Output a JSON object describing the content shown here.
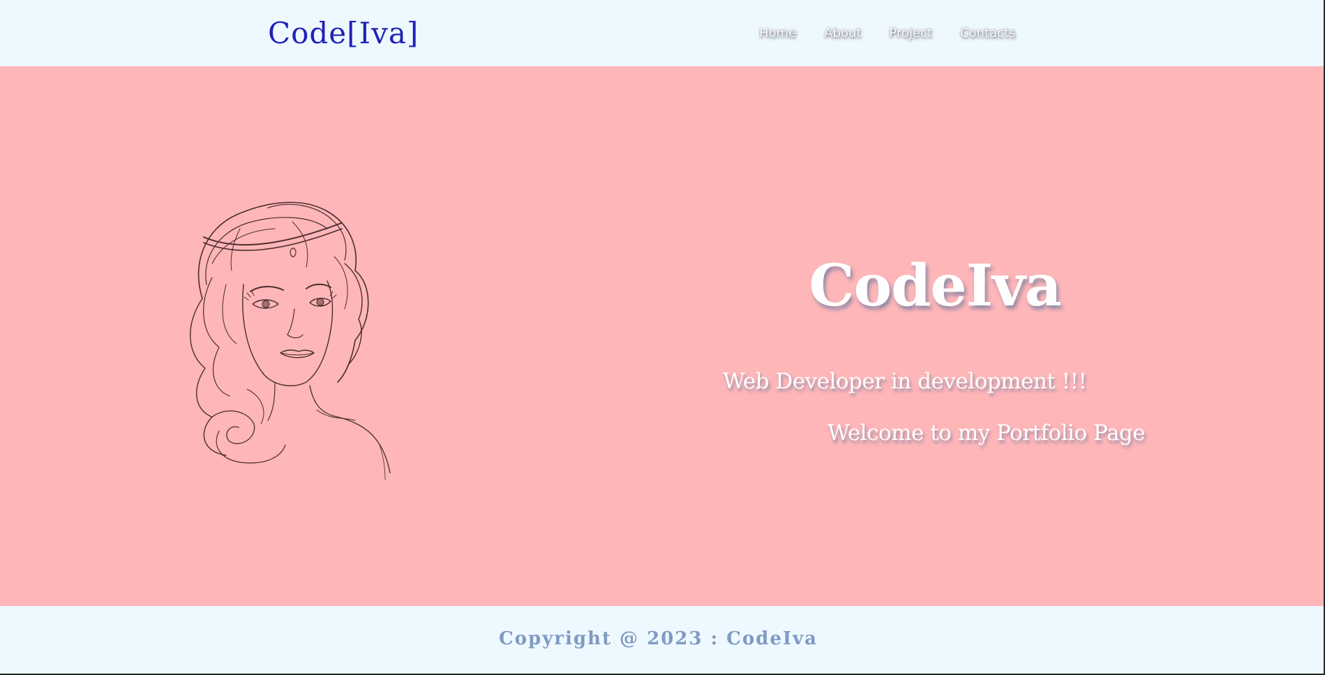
{
  "navbar": {
    "brand": "Code[Iva]",
    "links": [
      {
        "label": "Home"
      },
      {
        "label": "About"
      },
      {
        "label": "Project"
      },
      {
        "label": "Contacts"
      }
    ]
  },
  "hero": {
    "title": "CodeIva",
    "subtitle": "Web Developer in development !!!",
    "welcome": "Welcome to my Portfolio Page",
    "image": "woman-portrait-sketch"
  },
  "footer": {
    "copyright": "Copyright @ 2023 : CodeIva"
  },
  "colors": {
    "navbar_bg": "#eef8ff",
    "hero_bg": "#ffb6b8",
    "brand": "#1e23b4",
    "footer_text": "#7e9bc1"
  }
}
